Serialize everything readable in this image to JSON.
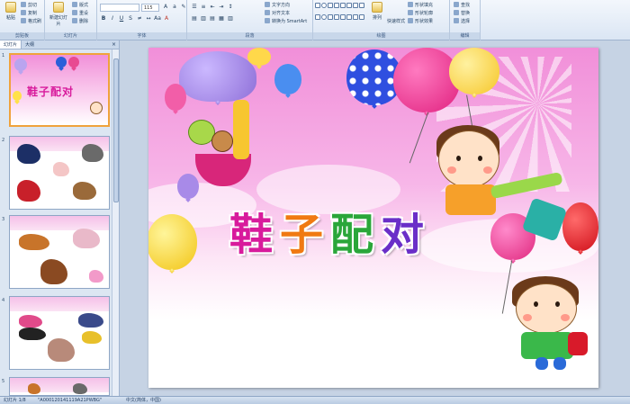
{
  "ribbon": {
    "clipboard": {
      "paste_label": "粘贴",
      "cut_label": "剪切",
      "copy_label": "复制",
      "format_painter_label": "格式刷",
      "group_label": "剪贴板"
    },
    "slides": {
      "new_slide_label": "新建幻灯片",
      "layout_label": "版式",
      "reset_label": "重设",
      "delete_label": "删除",
      "group_label": "幻灯片"
    },
    "font": {
      "font_name": "",
      "font_size": "115",
      "group_label": "字体"
    },
    "paragraph": {
      "text_direction_label": "文字方向",
      "align_text_label": "对齐文本",
      "smartart_label": "转换为 SmartArt",
      "group_label": "段落"
    },
    "drawing": {
      "arrange_label": "排列",
      "quick_styles_label": "快速样式",
      "fill_label": "形状填充",
      "outline_label": "形状轮廓",
      "effects_label": "形状效果",
      "group_label": "绘图"
    },
    "editing": {
      "find_label": "查找",
      "replace_label": "替换",
      "select_label": "选择",
      "group_label": "编辑"
    }
  },
  "pane": {
    "tabs": [
      "幻灯片",
      "大纲"
    ],
    "close_glyph": "×",
    "slide_numbers": [
      "1",
      "2",
      "3",
      "4",
      "5"
    ]
  },
  "slide": {
    "title_chars": [
      "鞋",
      "子",
      "配",
      "对"
    ],
    "title_colors": [
      "#d81b9c",
      "#f07a12",
      "#2aa63a",
      "#6a2fc8"
    ]
  },
  "thumbs": {
    "thumb1_title": "鞋子配对"
  },
  "status": {
    "slide_info": "幻灯片 1/8",
    "theme": "\"A000120141119A21PWBG\"",
    "language": "中文(简体，中国)"
  }
}
